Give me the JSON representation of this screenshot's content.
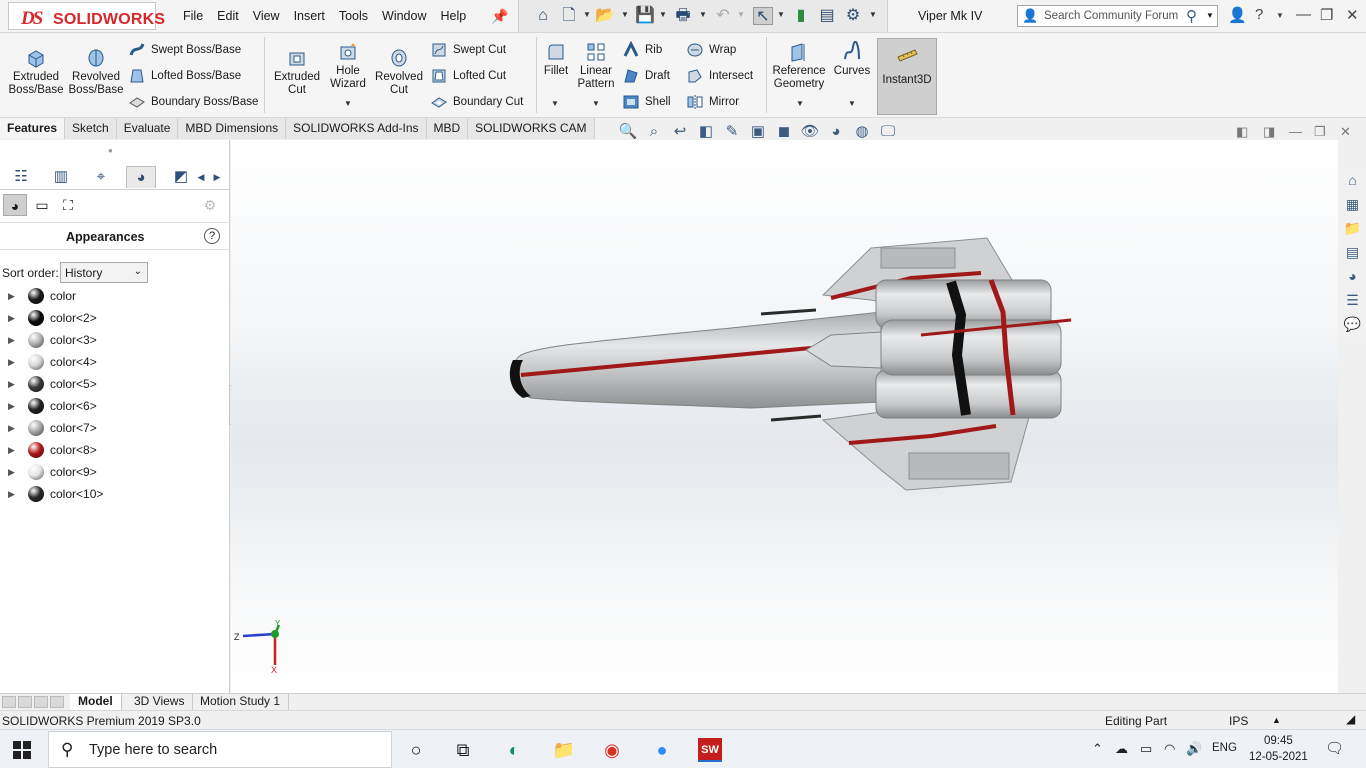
{
  "app": {
    "brand": "SOLIDWORKS",
    "document_title": "Viper Mk IV"
  },
  "menu": [
    "File",
    "Edit",
    "View",
    "Insert",
    "Tools",
    "Window",
    "Help"
  ],
  "search": {
    "placeholder": "Search Community Forum"
  },
  "ribbon": {
    "extruded_boss": "Extruded Boss/Base",
    "revolved_boss": "Revolved Boss/Base",
    "swept_boss": "Swept Boss/Base",
    "lofted_boss": "Lofted Boss/Base",
    "boundary_boss": "Boundary Boss/Base",
    "extruded_cut": "Extruded Cut",
    "hole_wizard": "Hole Wizard",
    "revolved_cut": "Revolved Cut",
    "swept_cut": "Swept Cut",
    "lofted_cut": "Lofted Cut",
    "boundary_cut": "Boundary Cut",
    "fillet": "Fillet",
    "linear_pattern": "Linear Pattern",
    "rib": "Rib",
    "draft": "Draft",
    "shell": "Shell",
    "wrap": "Wrap",
    "intersect": "Intersect",
    "mirror": "Mirror",
    "reference_geometry": "Reference Geometry",
    "curves": "Curves",
    "instant3d": "Instant3D"
  },
  "command_tabs": [
    "Features",
    "Sketch",
    "Evaluate",
    "MBD Dimensions",
    "SOLIDWORKS Add-Ins",
    "MBD",
    "SOLIDWORKS CAM"
  ],
  "panel": {
    "title": "Appearances",
    "sort_label": "Sort order:",
    "sort_value": "History",
    "items": [
      {
        "name": "color",
        "color": "#1a1a1a"
      },
      {
        "name": "color<2>",
        "color": "#0d0d0d"
      },
      {
        "name": "color<3>",
        "color": "#b5b5b5"
      },
      {
        "name": "color<4>",
        "color": "#d6d6d6"
      },
      {
        "name": "color<5>",
        "color": "#3a3a3a"
      },
      {
        "name": "color<6>",
        "color": "#222222"
      },
      {
        "name": "color<7>",
        "color": "#a8a8a8"
      },
      {
        "name": "color<8>",
        "color": "#b01818"
      },
      {
        "name": "color<9>",
        "color": "#e6e6e6"
      },
      {
        "name": "color<10>",
        "color": "#2a2a2a"
      }
    ]
  },
  "triad": {
    "x": "X",
    "y": "Y",
    "z": "Z"
  },
  "bottom_tabs": [
    "Model",
    "3D Views",
    "Motion Study 1"
  ],
  "status": {
    "product": "SOLIDWORKS Premium 2019 SP3.0",
    "mode": "Editing Part",
    "units": "IPS"
  },
  "taskbar": {
    "search_placeholder": "Type here to search",
    "language": "ENG",
    "time": "09:45",
    "date": "12-05-2021"
  },
  "colors": {
    "brand_red": "#d9262c",
    "hull_grey": "#c4c6c8",
    "stripe_red": "#a01818"
  }
}
